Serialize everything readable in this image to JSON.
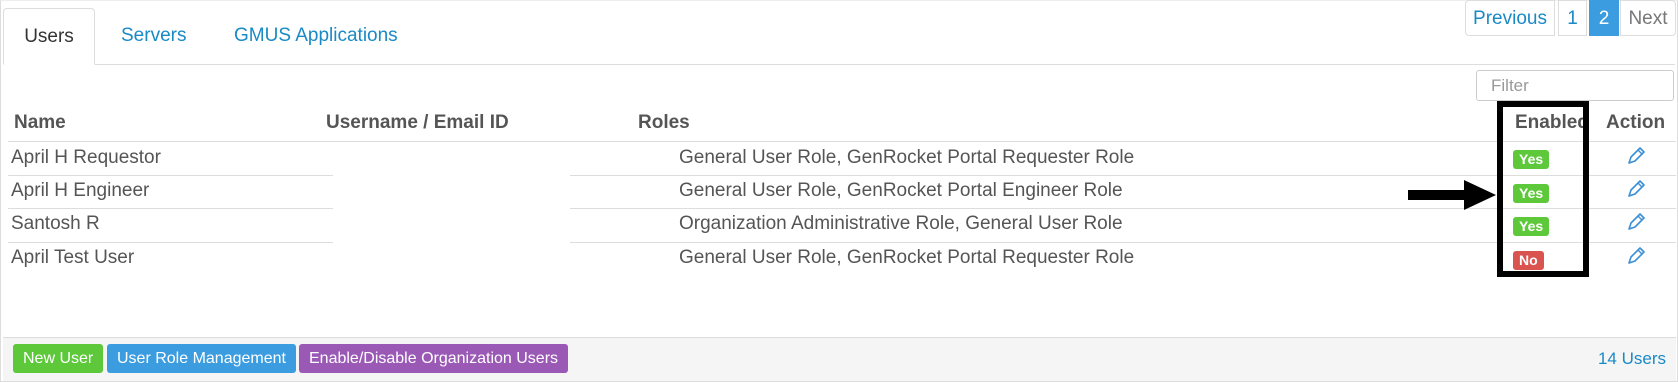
{
  "tabs": [
    {
      "label": "Users",
      "active": true
    },
    {
      "label": "Servers",
      "active": false
    },
    {
      "label": "GMUS Applications",
      "active": false
    }
  ],
  "filter": {
    "placeholder": "Filter",
    "value": ""
  },
  "table": {
    "headers": {
      "name": "Name",
      "username": "Username / Email ID",
      "roles": "Roles",
      "enabled": "Enabled",
      "action": "Action"
    },
    "rows": [
      {
        "name": "April H Requestor",
        "username": "",
        "roles": "General User Role, GenRocket Portal Requester Role",
        "enabled": "Yes",
        "action_icon": "pencil-icon"
      },
      {
        "name": "April H Engineer",
        "username": "",
        "roles": "General User Role, GenRocket Portal Engineer Role",
        "enabled": "Yes",
        "action_icon": "pencil-icon"
      },
      {
        "name": "Santosh R",
        "username": "",
        "roles": "Organization Administrative Role, General User Role",
        "enabled": "Yes",
        "action_icon": "pencil-icon"
      },
      {
        "name": "April Test User",
        "username": "",
        "roles": "General User Role, GenRocket Portal Requester Role",
        "enabled": "No",
        "action_icon": "pencil-icon"
      }
    ]
  },
  "pagination": {
    "previous": "Previous",
    "pages": [
      "1",
      "2"
    ],
    "current": "2",
    "next": "Next"
  },
  "footer": {
    "new_user": "New User",
    "role_mgmt": "User Role Management",
    "enable_disable": "Enable/Disable Organization Users",
    "count": "14 Users"
  },
  "colors": {
    "link": "#1a8ac6",
    "yes_badge": "#5cc83a",
    "no_badge": "#d9534f",
    "role_button": "#3b9de0",
    "enable_button": "#9b59b6",
    "annotation": "#000000"
  }
}
